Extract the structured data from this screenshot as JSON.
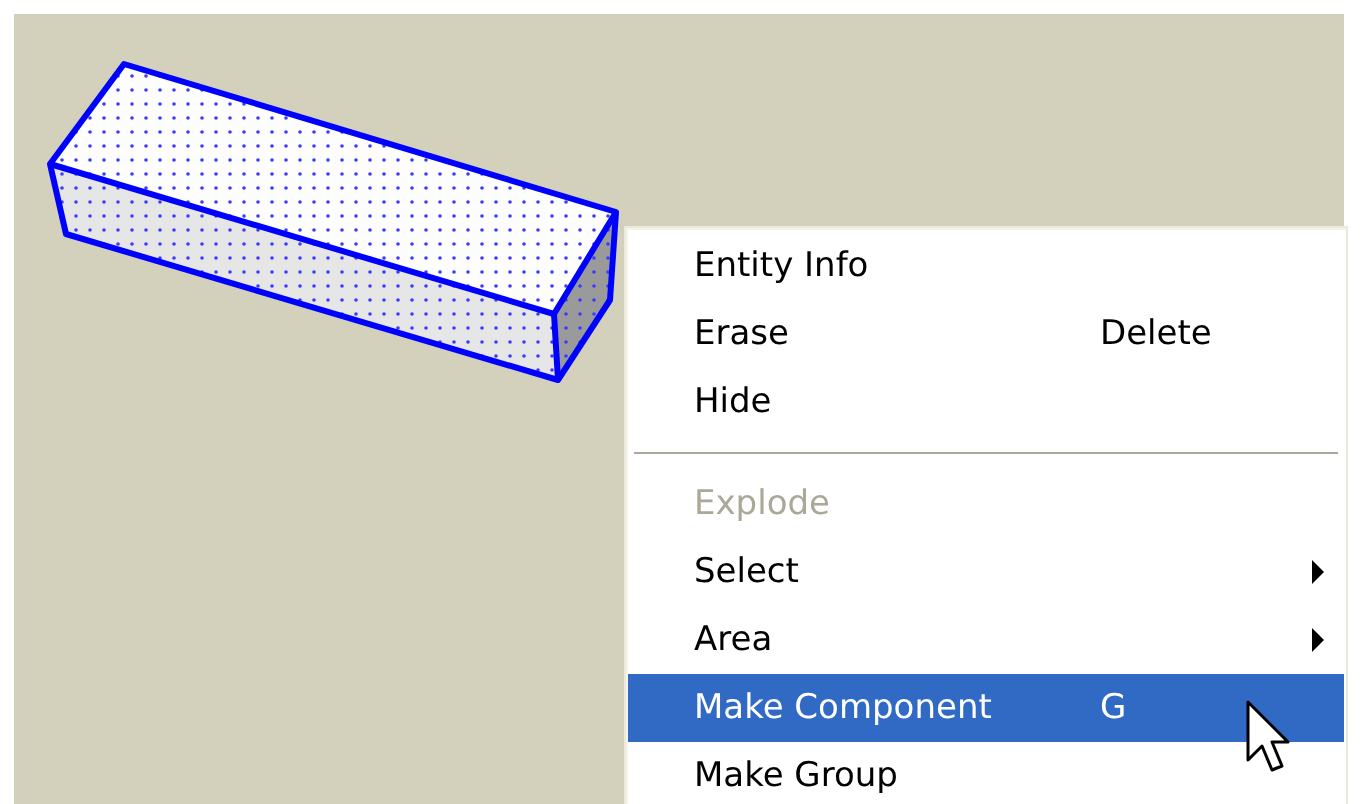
{
  "context_menu": {
    "items": [
      {
        "kind": "item",
        "label": "Entity Info",
        "disabled": false,
        "selected": false
      },
      {
        "kind": "item",
        "label": "Erase",
        "shortcut": "Delete",
        "disabled": false,
        "selected": false
      },
      {
        "kind": "item",
        "label": "Hide",
        "disabled": false,
        "selected": false
      },
      {
        "kind": "separator"
      },
      {
        "kind": "item",
        "label": "Explode",
        "disabled": true,
        "selected": false
      },
      {
        "kind": "item",
        "label": "Select",
        "submenu": true,
        "disabled": false,
        "selected": false
      },
      {
        "kind": "item",
        "label": "Area",
        "submenu": true,
        "disabled": false,
        "selected": false
      },
      {
        "kind": "item",
        "label": "Make Component",
        "shortcut": "G",
        "disabled": false,
        "selected": true
      },
      {
        "kind": "item",
        "label": "Make Group",
        "disabled": false,
        "selected": false
      }
    ]
  }
}
